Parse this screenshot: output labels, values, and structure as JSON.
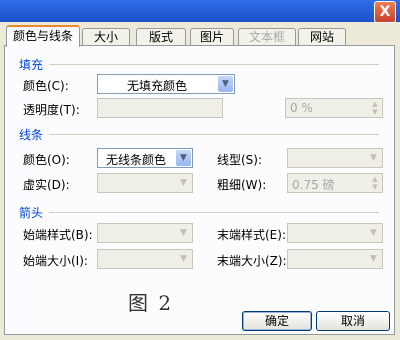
{
  "window": {
    "close_label": "X"
  },
  "tabs": [
    {
      "label": "颜色与线条"
    },
    {
      "label": "大小"
    },
    {
      "label": "版式"
    },
    {
      "label": "图片"
    },
    {
      "label": "文本框"
    },
    {
      "label": "网站"
    }
  ],
  "fill": {
    "heading": "填充",
    "color_label": "颜色(C):",
    "color_value": "无填充颜色",
    "transparency_label": "透明度(T):",
    "transparency_value": "0 %"
  },
  "line": {
    "heading": "线条",
    "color_label": "颜色(O):",
    "color_value": "无线条颜色",
    "dash_label": "虚实(D):",
    "style_label": "线型(S):",
    "weight_label": "粗细(W):",
    "weight_value": "0.75 磅"
  },
  "arrows": {
    "heading": "箭头",
    "begin_style_label": "始端样式(B):",
    "end_style_label": "末端样式(E):",
    "begin_size_label": "始端大小(I):",
    "end_size_label": "末端大小(Z):"
  },
  "caption": "图 2",
  "buttons": {
    "ok": "确定",
    "cancel": "取消"
  },
  "colors": {
    "accent": "#0046d5",
    "tab_highlight": "#e68b2c",
    "titlebar": "#2f6ee6"
  }
}
